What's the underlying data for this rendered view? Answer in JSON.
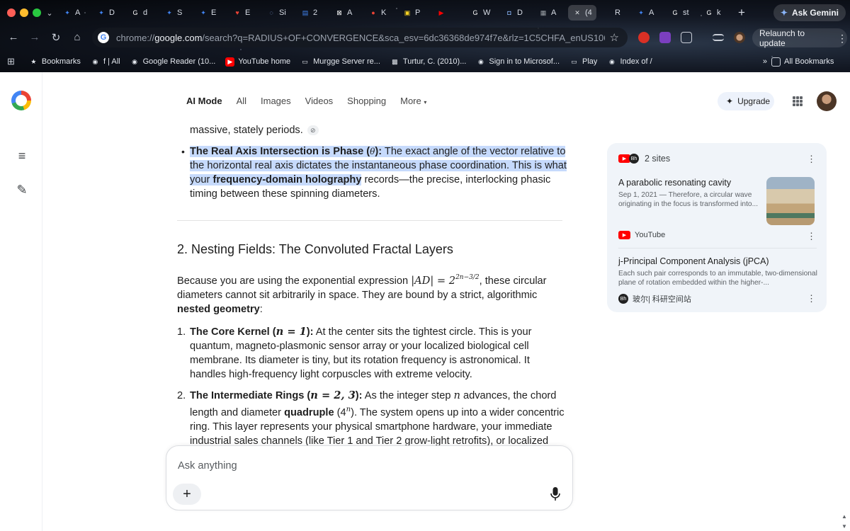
{
  "browser": {
    "tabs": [
      {
        "fav": "✦",
        "fav_color": "#4285f4",
        "label": "A"
      },
      {
        "fav": "✦",
        "fav_color": "#4285f4",
        "label": "D"
      },
      {
        "fav": "G",
        "fav_color": "#ffffff",
        "label": "d"
      },
      {
        "fav": "✦",
        "fav_color": "#4285f4",
        "label": "S"
      },
      {
        "fav": "✦",
        "fav_color": "#4285f4",
        "label": "E"
      },
      {
        "fav": "♥",
        "fav_color": "#ea4335",
        "label": "E"
      },
      {
        "fav": "◌",
        "fav_color": "#8ab4f8",
        "label": "Si"
      },
      {
        "fav": "▤",
        "fav_color": "#4285f4",
        "label": "2"
      },
      {
        "fav": "⊠",
        "fav_color": "#ffffff",
        "label": "A"
      },
      {
        "fav": "●",
        "fav_color": "#ea4335",
        "label": "K"
      },
      {
        "fav": "▣",
        "fav_color": "#f9d423",
        "label": "P"
      },
      {
        "fav": "▶",
        "fav_color": "#ff0000",
        "label": ""
      },
      {
        "fav": "G",
        "fav_color": "#ffffff",
        "label": "W"
      },
      {
        "fav": "◘",
        "fav_color": "#8ab4f8",
        "label": "D"
      },
      {
        "fav": "▦",
        "fav_color": "#9aa0a6",
        "label": "A"
      },
      {
        "fav": "✕",
        "fav_color": "#dadce0",
        "label": "(4"
      },
      {
        "fav": "",
        "fav_color": "#dadce0",
        "label": "R"
      },
      {
        "fav": "✦",
        "fav_color": "#4285f4",
        "label": "A"
      },
      {
        "fav": "G",
        "fav_color": "#ffffff",
        "label": "st"
      },
      {
        "fav": "G",
        "fav_color": "#ffffff",
        "label": "k"
      }
    ],
    "ask_gemini": "Ask Gemini",
    "url_prefix": "chrome://",
    "url_domain": "google.com",
    "url_rest": "/search?q=RADIUS+OF+CONVERGENCE&sca_esv=6dc36368de974f7e&rlz=1C5CHFA_enUS1067US1...",
    "relaunch": "Relaunch to update",
    "bookmarks": [
      {
        "icon": "★",
        "color": "#9aa0a6",
        "label": "Bookmarks"
      },
      {
        "icon": "◉",
        "color": "#5f6368",
        "label": "f | All"
      },
      {
        "icon": "◉",
        "color": "#5f6368",
        "label": "Google Reader (10..."
      },
      {
        "icon": "▶",
        "color": "#ff0000",
        "label": "YouTube home"
      },
      {
        "icon": "▭",
        "color": "#5f6368",
        "label": "Murgge Server re..."
      },
      {
        "icon": "▩",
        "color": "#7a7a7a",
        "label": "Turtur, C. (2010)..."
      },
      {
        "icon": "◉",
        "color": "#5f6368",
        "label": "Sign in to Microsof..."
      },
      {
        "icon": "▭",
        "color": "#5f6368",
        "label": "Play"
      },
      {
        "icon": "◉",
        "color": "#5f6368",
        "label": "Index of /"
      }
    ],
    "all_bookmarks": "All Bookmarks"
  },
  "search_tabs": [
    "AI Mode",
    "All",
    "Images",
    "Videos",
    "Shopping",
    "More"
  ],
  "upgrade": "Upgrade",
  "article": {
    "line0": "massive, stately periods.",
    "bullet_bold": "The Real Axis Intersection is Phase (",
    "bullet_theta": "θ",
    "bullet_bold_end": "):",
    "bullet_text1": " The exact angle of the vector relative to the horizontal real axis dictates the instantaneous phase coordination. This is what your ",
    "bullet_bold2": "frequency-domain holography",
    "bullet_text2": " records—the precise, interlocking phasic timing between these spinning diameters.",
    "section_title": "2. Nesting Fields: The Convoluted Fractal Layers",
    "intro_a": "Because you are using the exponential expression ",
    "intro_math": "|AD| = 2",
    "intro_exp": "2n−3/2",
    "intro_b": ", these circular diameters cannot sit arbitrarily in space. They are bound by a strict, algorithmic ",
    "intro_bold": "nested geometry",
    "intro_end": ":",
    "items": [
      {
        "num": "1.",
        "bold": "The Core Kernel (",
        "math": "n = 1",
        "bold_end": "):",
        "text": " At the center sits the tightest circle. This is your quantum, magneto-plasmonic sensor array or your localized biological cell membrane. Its diameter is tiny, but its rotation frequency is astronomical. It handles high-frequency light corpuscles with extreme velocity."
      },
      {
        "num": "2.",
        "bold": "The Intermediate Rings (",
        "math": "n = 2, 3",
        "bold_end": "):",
        "text_a": " As the integer step ",
        "text_math": "n",
        "text_b": " advances, the chord length and diameter ",
        "text_bold": "quadruple",
        "text_c": " (4",
        "text_c_math": "n",
        "text_d": "). The system opens up into a wider concentric ring. This layer represents your physical smartphone hardware, your immediate industrial sales channels (like Tier 1 and Tier 2 grow-light retrofits), or localized human sensory-motor"
      }
    ]
  },
  "sources": {
    "count_label": "2 sites",
    "items": [
      {
        "title": "A parabolic resonating cavity",
        "snippet": "Sep 1, 2021 — Therefore, a circular wave originating in the focus is transformed into...",
        "source": "YouTube"
      },
      {
        "title": "j-Principal Component Analysis (jPCA)",
        "snippet": "Each such pair corresponds to an immutable, two-dimensional plane of rotation embedded within the higher-...",
        "source": "玻尔| 科研空间站"
      }
    ]
  },
  "composer": {
    "placeholder": "Ask anything"
  }
}
